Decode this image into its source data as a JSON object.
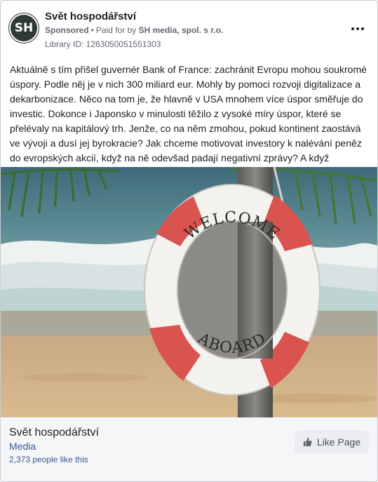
{
  "header": {
    "avatar_initials": "SH",
    "page_name": "Svět hospodářství",
    "sponsored": "Sponsored",
    "separator": "•",
    "paid_for_prefix": "Paid for by",
    "payer": "SH media, spol. s r.o.",
    "library_id": "Library ID: 1263050051551303"
  },
  "post": {
    "text": "Aktuálně s tím přišel guvernér Bank of France: zachránit Evropu mohou soukromé úspory. Podle něj je v nich 300 miliard eur. Mohly by pomoci rozvoji digitalizace a dekarbonizace. Něco na tom je, že hlavně v USA mnohem více úspor směřuje do investic. Dokonce i Japonsko v minulosti těžilo z vysoké míry úspor, které se přelévaly na kapitálový trh. Jenže, co na něm zmohou, pokud kontinent zaostává ve vývoji a dusí jej byrokracie? Jak chceme motivovat investory k nalévání peněz do evropských akcií, když na ně odevšad padají negativní zprávy? A když světem…"
  },
  "image": {
    "ring_text_top": "WELCOME",
    "ring_text_bottom": "ABOARD"
  },
  "footer": {
    "page_name": "Svět hospodářství",
    "category": "Media",
    "likes": "2,373 people like this",
    "like_button_label": "Like Page"
  },
  "colors": {
    "accent_link": "#385898",
    "ring_red": "#d9534f",
    "ring_white": "#f4f4f2"
  },
  "icons": [
    "more-options-icon",
    "thumbs-up-icon"
  ]
}
